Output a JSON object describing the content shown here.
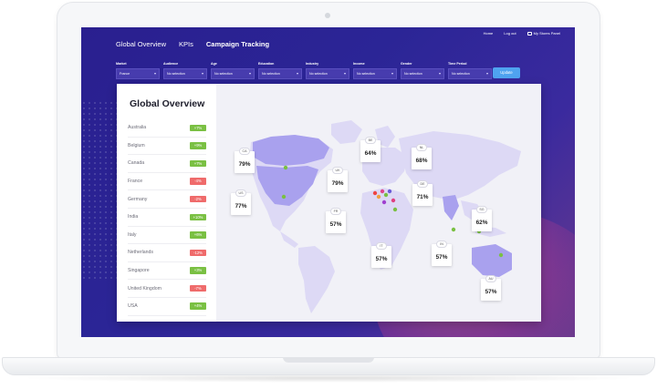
{
  "nav": {
    "items": [
      "Global Overview",
      "KPIs",
      "Campaign Tracking"
    ],
    "utility": [
      "Home",
      "Log out",
      "My Stores Panel"
    ]
  },
  "filters": [
    {
      "label": "Market",
      "value": "France"
    },
    {
      "label": "Audience",
      "value": "No selection"
    },
    {
      "label": "Age",
      "value": "No selection"
    },
    {
      "label": "Education",
      "value": "No selection"
    },
    {
      "label": "Industry",
      "value": "No selection"
    },
    {
      "label": "Income",
      "value": "No selection"
    },
    {
      "label": "Gender",
      "value": "No selection"
    },
    {
      "label": "Time Period",
      "value": "No selection"
    }
  ],
  "update_label": "Update",
  "panel_title": "Global Overview",
  "countries": [
    {
      "name": "Australia",
      "change": "+7%",
      "positive": true
    },
    {
      "name": "Belgium",
      "change": "+9%",
      "positive": true
    },
    {
      "name": "Canada",
      "change": "+7%",
      "positive": true
    },
    {
      "name": "France",
      "change": "-4%",
      "positive": false
    },
    {
      "name": "Germany",
      "change": "-2%",
      "positive": false
    },
    {
      "name": "India",
      "change": "+10%",
      "positive": true
    },
    {
      "name": "Italy",
      "change": "+6%",
      "positive": true
    },
    {
      "name": "Netherlands",
      "change": "-12%",
      "positive": false
    },
    {
      "name": "Singapore",
      "change": "+3%",
      "positive": true
    },
    {
      "name": "United Kingdom",
      "change": "-7%",
      "positive": false
    },
    {
      "name": "USA",
      "change": "+4%",
      "positive": true
    }
  ],
  "map_labels": [
    {
      "code": "CA",
      "value": "79%"
    },
    {
      "code": "US",
      "value": "77%"
    },
    {
      "code": "BE",
      "value": "64%"
    },
    {
      "code": "UK",
      "value": "79%"
    },
    {
      "code": "FR",
      "value": "57%"
    },
    {
      "code": "NL",
      "value": "68%"
    },
    {
      "code": "DE",
      "value": "71%"
    },
    {
      "code": "IT",
      "value": "57%"
    },
    {
      "code": "IN",
      "value": "57%"
    },
    {
      "code": "SG",
      "value": "62%"
    },
    {
      "code": "AU",
      "value": "57%"
    }
  ],
  "colors": {
    "positive": "#7ac043",
    "negative": "#ef6b6b",
    "land": "#ddd9f5",
    "highlight": "#a9a1ee",
    "accent": "#4fa3f0"
  }
}
